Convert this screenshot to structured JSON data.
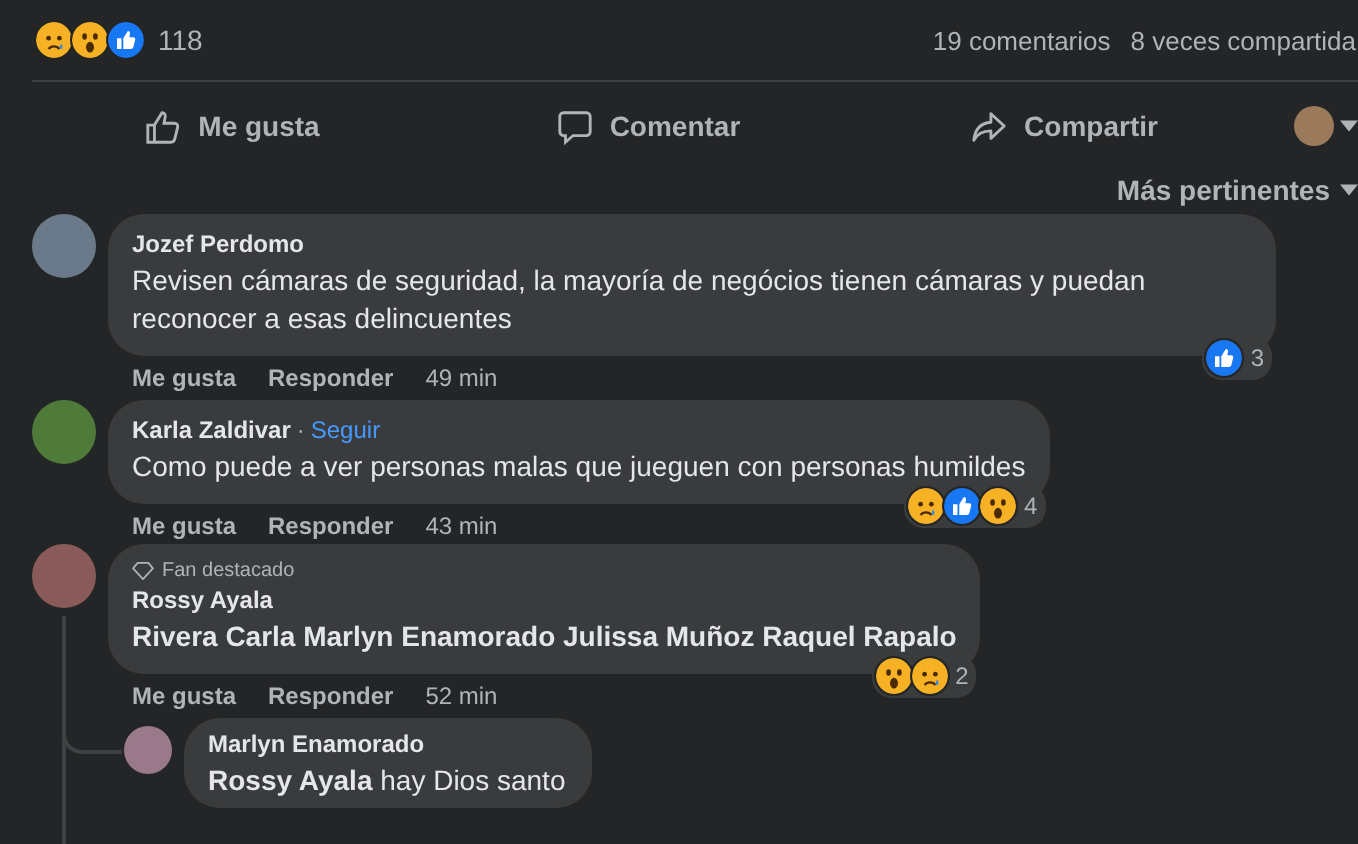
{
  "post_stats": {
    "reactions": [
      {
        "kind": "sad"
      },
      {
        "kind": "wow"
      },
      {
        "kind": "like"
      }
    ],
    "reaction_count": "118",
    "comments": "19 comentarios",
    "shares": "8 veces compartida"
  },
  "actions": [
    {
      "kind": "like",
      "label": "Me gusta"
    },
    {
      "kind": "comment",
      "label": "Comentar"
    },
    {
      "kind": "share",
      "label": "Compartir"
    }
  ],
  "sort": {
    "label": "Más pertinentes"
  },
  "comments": [
    {
      "author": "Jozef Perdomo",
      "text": "Revisen cámaras de seguridad, la mayoría de negócios tienen cámaras y puedan reconocer a esas delincuentes",
      "like": "Me gusta",
      "reply": "Responder",
      "time": "49 min",
      "reactions": [
        {
          "kind": "like"
        }
      ],
      "reaction_count": "3",
      "bold_text": false
    },
    {
      "author": "Karla Zaldivar",
      "separator": "·",
      "follow": "Seguir",
      "text": "Como puede a ver personas malas que jueguen con personas humildes",
      "like": "Me gusta",
      "reply": "Responder",
      "time": "43 min",
      "reactions": [
        {
          "kind": "sad"
        },
        {
          "kind": "like"
        },
        {
          "kind": "wow"
        }
      ],
      "reaction_count": "4",
      "bold_text": false
    },
    {
      "badge": "Fan destacado",
      "author": "Rossy Ayala",
      "text": "Rivera Carla Marlyn Enamorado Julissa Muñoz Raquel Rapalo",
      "like": "Me gusta",
      "reply": "Responder",
      "time": "52 min",
      "reactions": [
        {
          "kind": "wow"
        },
        {
          "kind": "sad"
        }
      ],
      "reaction_count": "2",
      "bold_text": true,
      "replies": [
        {
          "author": "Marlyn Enamorado",
          "text": "**Rossy Ayala** hay Dios santo"
        }
      ]
    }
  ]
}
